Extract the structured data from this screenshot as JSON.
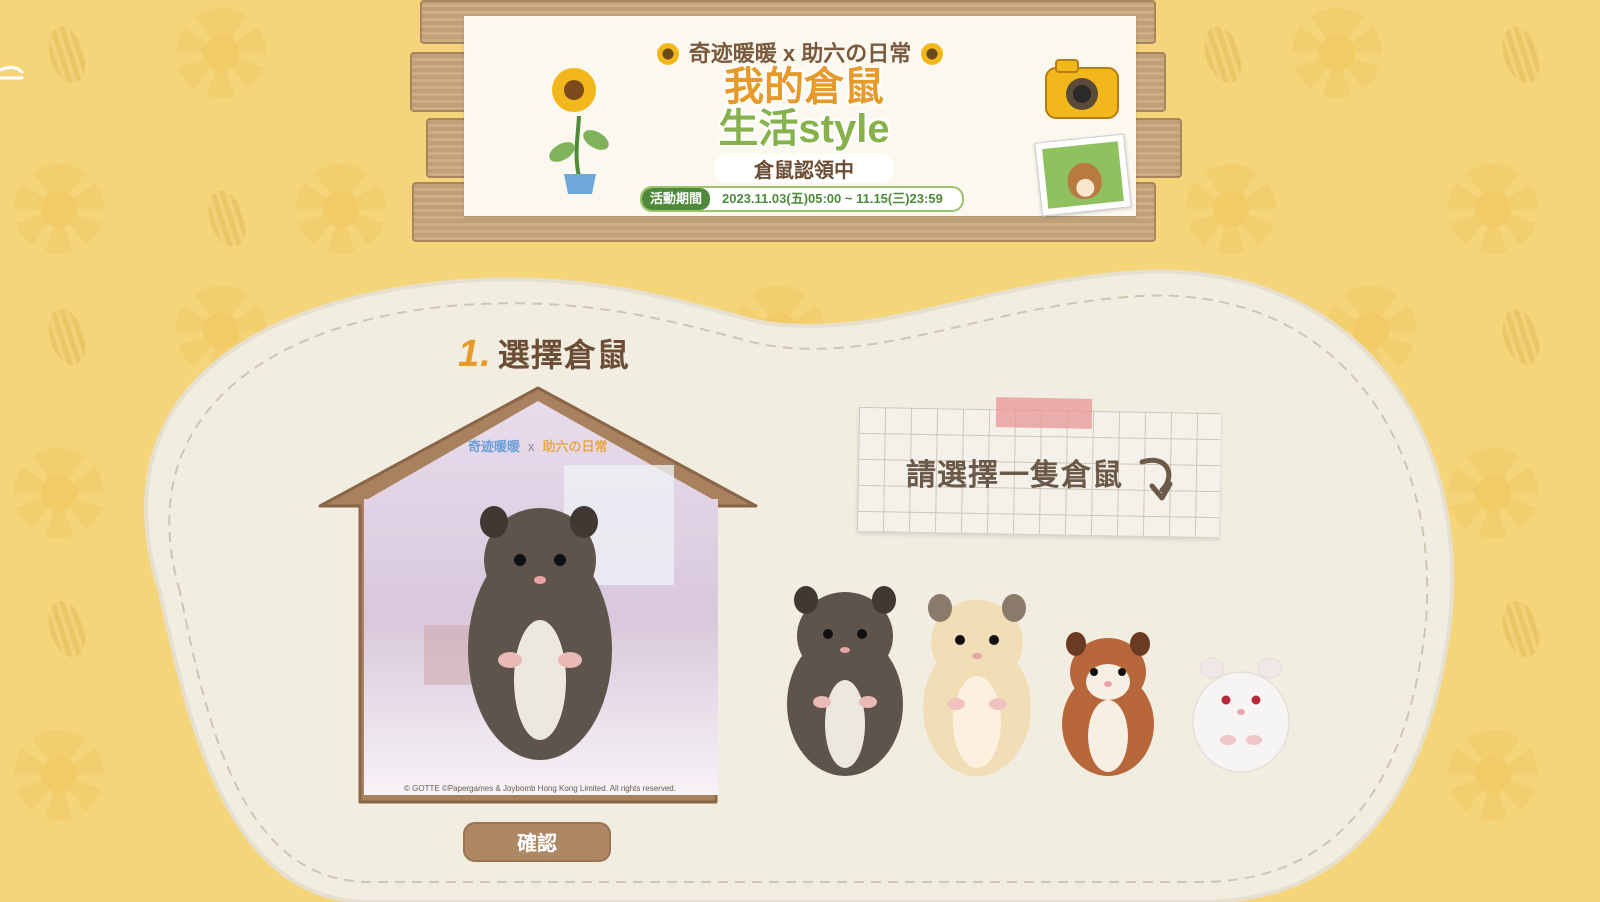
{
  "banner": {
    "collab_title": "奇迹暖暖 x 助六の日常",
    "title_line1": "我的倉鼠",
    "title_line2": "生活style",
    "subtitle": "倉鼠認領中",
    "period_label": "活動期間",
    "period_dates": "2023.11.03(五)05:00 ~ 11.15(三)23:59"
  },
  "step": {
    "number": "1.",
    "title": "選擇倉鼠"
  },
  "preview": {
    "copyright": "© GOTTE ©Papergames & Joybomb Hong Kong Limited. All rights reserved.",
    "collab_left": "奇迹暖暖",
    "collab_x": "x",
    "collab_right": "助六の日常"
  },
  "confirm_label": "確認",
  "note_text": "請選擇一隻倉鼠",
  "hamsters": [
    {
      "name": "dark-brown",
      "color": "#5e544c",
      "belly": "#e9e4dc"
    },
    {
      "name": "cream",
      "color": "#f1ddb6",
      "belly": "#fbf1de"
    },
    {
      "name": "orange",
      "color": "#b8673a",
      "belly": "#f6efe4"
    },
    {
      "name": "white",
      "color": "#f7f5f3",
      "belly": "#ffffff"
    }
  ],
  "colors": {
    "background": "#f5d57a",
    "panel": "#f1ede1",
    "wood": "#a8825f",
    "text_brown": "#6b4e35",
    "accent_orange": "#e69a2a"
  }
}
